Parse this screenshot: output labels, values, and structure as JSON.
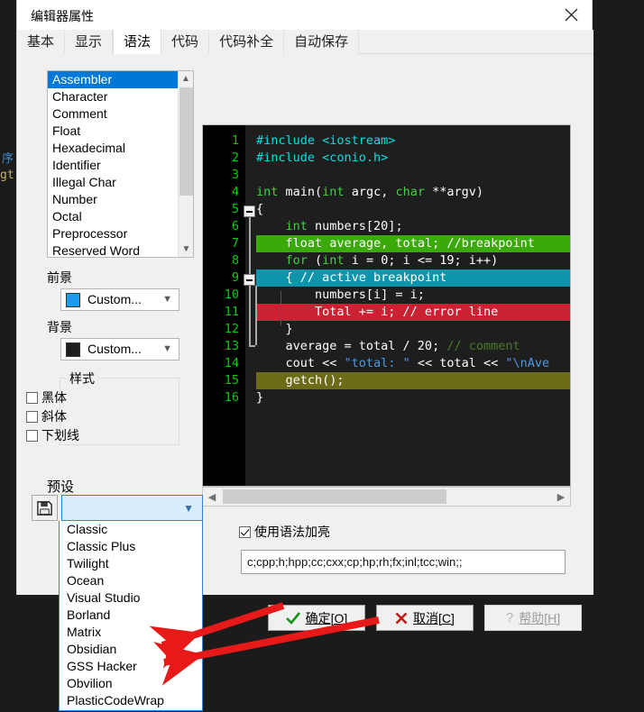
{
  "window": {
    "title": "编辑器属性",
    "close_icon": "close-icon"
  },
  "tabs": [
    {
      "label": "基本",
      "active": false
    },
    {
      "label": "显示",
      "active": false
    },
    {
      "label": "语法",
      "active": true
    },
    {
      "label": "代码",
      "active": false
    },
    {
      "label": "代码补全",
      "active": false
    },
    {
      "label": "自动保存",
      "active": false
    }
  ],
  "element_list": {
    "items": [
      "Assembler",
      "Character",
      "Comment",
      "Float",
      "Hexadecimal",
      "Identifier",
      "Illegal Char",
      "Number",
      "Octal",
      "Preprocessor",
      "Reserved Word"
    ],
    "selected": "Assembler"
  },
  "foreground": {
    "label": "前景",
    "value": "Custom...",
    "color": "#1a9bf0"
  },
  "background": {
    "label": "背景",
    "value": "Custom...",
    "color": "#1e1e1e"
  },
  "style_group": {
    "title": "样式",
    "options": [
      {
        "label": "黑体",
        "checked": false
      },
      {
        "label": "斜体",
        "checked": false
      },
      {
        "label": "下划线",
        "checked": false
      }
    ]
  },
  "preset": {
    "label": "预设",
    "save_icon": "floppy-disk-icon",
    "value": "",
    "options": [
      "Classic",
      "Classic Plus",
      "Twilight",
      "Ocean",
      "Visual Studio",
      "Borland",
      "Matrix",
      "Obsidian",
      "GSS Hacker",
      "Obvilion",
      "PlasticCodeWrap"
    ]
  },
  "syntax_highlight": {
    "label": "使用语法加亮",
    "checked": true
  },
  "extensions": {
    "value": "c;cpp;h;hpp;cc;cxx;cp;hp;rh;fx;inl;tcc;win;;"
  },
  "buttons": {
    "ok": "确定[O]",
    "cancel": "取消[C]",
    "help": "帮助[H]",
    "help_disabled": true
  },
  "code_preview": {
    "colors": {
      "background": "#1e1e1e",
      "gutter": "#000000",
      "line_number": "#00d000",
      "preprocessor": "#00e1e1",
      "keyword": "#44d044",
      "text": "#ffffff",
      "string": "#4a9ae8",
      "comment": "#4a7a2a",
      "breakpoint_bg": "#3aa90a",
      "active_breakpoint_bg": "#0d96ab",
      "error_bg": "#cc2133",
      "current_line_bg": "#6b6b18"
    },
    "lines": [
      {
        "n": "1",
        "segs": [
          {
            "t": "#include ",
            "c": "t-pre"
          },
          {
            "t": "<iostream>",
            "c": "t-pre"
          }
        ]
      },
      {
        "n": "2",
        "segs": [
          {
            "t": "#include ",
            "c": "t-pre"
          },
          {
            "t": "<conio.h>",
            "c": "t-pre"
          }
        ]
      },
      {
        "n": "3",
        "segs": []
      },
      {
        "n": "4",
        "segs": [
          {
            "t": "int",
            "c": "t-kw"
          },
          {
            "t": " main(",
            "c": "t-txt"
          },
          {
            "t": "int",
            "c": "t-kw"
          },
          {
            "t": " argc, ",
            "c": "t-txt"
          },
          {
            "t": "char",
            "c": "t-kw"
          },
          {
            "t": " **argv)",
            "c": "t-txt"
          }
        ]
      },
      {
        "n": "5",
        "segs": [
          {
            "t": "{",
            "c": "t-txt"
          }
        ]
      },
      {
        "n": "6",
        "segs": [
          {
            "t": "    ",
            "c": "t-txt"
          },
          {
            "t": "int",
            "c": "t-kw"
          },
          {
            "t": " numbers[20];",
            "c": "t-txt"
          }
        ]
      },
      {
        "n": "7",
        "bg": "breakpoint",
        "segs": [
          {
            "t": "    ",
            "c": "t-txt"
          },
          {
            "t": "float",
            "c": "t-txt"
          },
          {
            "t": " average, total; //breakpoint",
            "c": "t-txt"
          }
        ]
      },
      {
        "n": "8",
        "segs": [
          {
            "t": "    ",
            "c": "t-txt"
          },
          {
            "t": "for",
            "c": "t-kw"
          },
          {
            "t": " (",
            "c": "t-txt"
          },
          {
            "t": "int",
            "c": "t-kw"
          },
          {
            "t": " i = 0; i <= 19; i++)",
            "c": "t-txt"
          }
        ]
      },
      {
        "n": "9",
        "bg": "active",
        "segs": [
          {
            "t": "    { // active breakpoint",
            "c": "t-txt"
          }
        ]
      },
      {
        "n": "10",
        "segs": [
          {
            "t": "        numbers[i] = i;",
            "c": "t-txt"
          }
        ]
      },
      {
        "n": "11",
        "bg": "error",
        "segs": [
          {
            "t": "        Total += i; // error line",
            "c": "t-txt"
          }
        ]
      },
      {
        "n": "12",
        "segs": [
          {
            "t": "    }",
            "c": "t-txt"
          }
        ]
      },
      {
        "n": "13",
        "segs": [
          {
            "t": "    average = total / 20; ",
            "c": "t-txt"
          },
          {
            "t": "// comment",
            "c": "t-cmt"
          }
        ]
      },
      {
        "n": "14",
        "segs": [
          {
            "t": "    cout << ",
            "c": "t-txt"
          },
          {
            "t": "\"total: \"",
            "c": "t-str"
          },
          {
            "t": " << total << ",
            "c": "t-txt"
          },
          {
            "t": "\"\\nAve",
            "c": "t-str"
          }
        ]
      },
      {
        "n": "15",
        "bg": "current",
        "segs": [
          {
            "t": "    getch();",
            "c": "t-txt"
          }
        ]
      },
      {
        "n": "16",
        "segs": [
          {
            "t": "}",
            "c": "t-txt"
          }
        ]
      }
    ]
  },
  "background_editor": {
    "line1": "序",
    "line2": "gt"
  },
  "annotations": {
    "arrow_color": "#e81919",
    "arrow_targets": [
      "Obsidian",
      "GSS Hacker"
    ]
  }
}
